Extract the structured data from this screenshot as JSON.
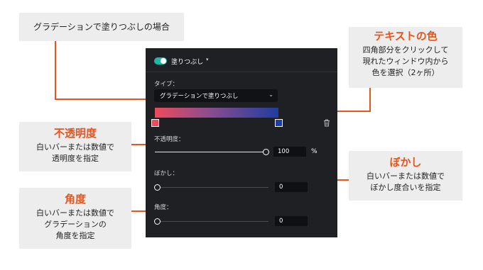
{
  "callouts": {
    "gradient_case": {
      "text": "グラデーションで塗りつぶしの場合"
    },
    "text_color": {
      "title": "テキストの色",
      "lines": [
        "四角部分をクリックして",
        "現れたウィンドウ内から",
        "色を選択（2ヶ所）"
      ]
    },
    "opacity": {
      "title": "不透明度",
      "lines": [
        "白いバーまたは数値で",
        "透明度を指定"
      ]
    },
    "blur": {
      "title": "ぼかし",
      "lines": [
        "白いバーまたは数値で",
        "ぼかし度合いを指定"
      ]
    },
    "angle": {
      "title": "角度",
      "lines": [
        "白いバーまたは数値で",
        "グラデーションの",
        "角度を指定"
      ]
    }
  },
  "panel": {
    "fill_label": "塗りつぶし",
    "fill_enabled": true,
    "type_label": "タイプ：",
    "type_value": "グラデーションで塗りつぶし",
    "gradient": {
      "start_color": "#ee4a5c",
      "end_color": "#1f3da0"
    },
    "opacity": {
      "label": "不透明度：",
      "value": "100",
      "unit": "%",
      "level": 1.0
    },
    "blur": {
      "label": "ぼかし：",
      "value": "0",
      "level": 0.0
    },
    "angle": {
      "label": "角度：",
      "value": "0",
      "level": 0.0
    }
  },
  "colors": {
    "accent": "#e8541e",
    "panel_bg": "#1e2024",
    "toggle_on": "#1bb9a8"
  },
  "icons": {
    "toggle": "toggle-icon",
    "dropdown": "chevron-down-icon",
    "delete": "trash-icon"
  }
}
